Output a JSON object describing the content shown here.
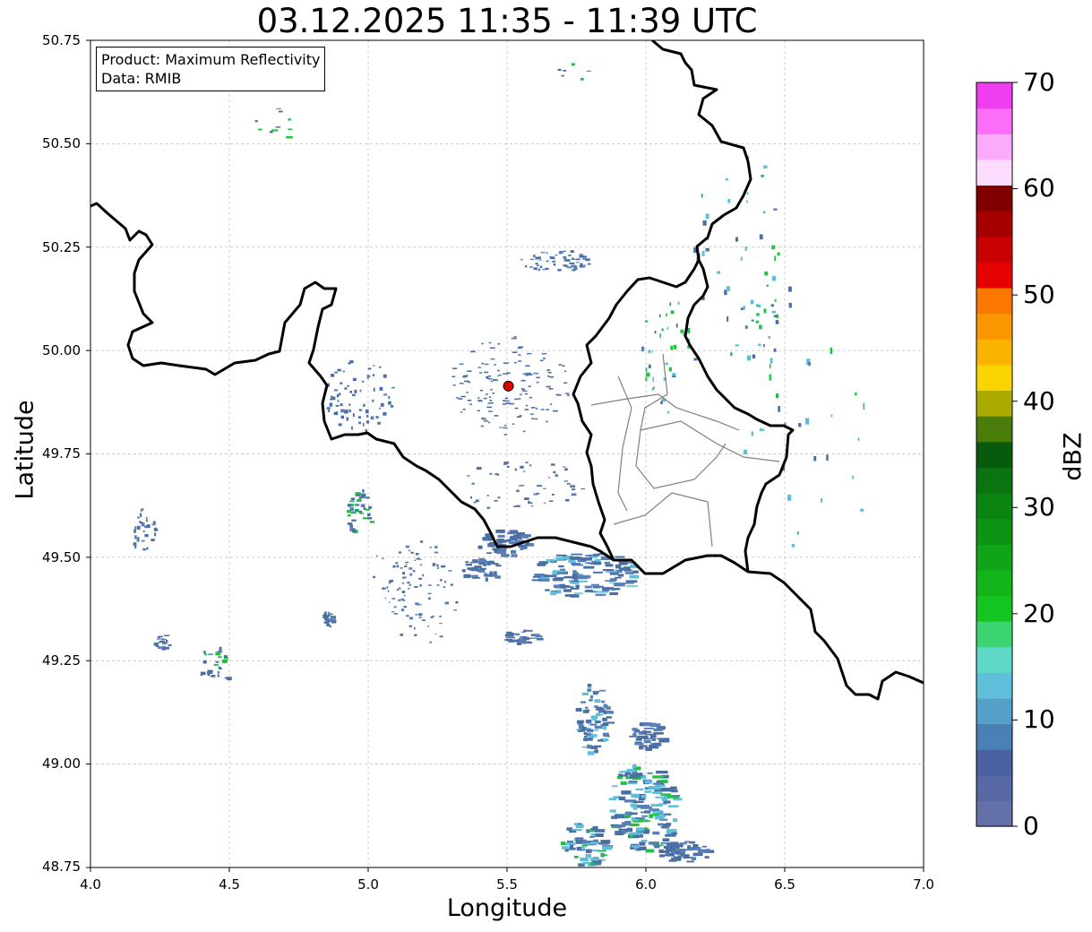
{
  "title": "03.12.2025 11:35 - 11:39 UTC",
  "info": {
    "product": "Product: Maximum Reflectivity",
    "data_source": "Data: RMIB"
  },
  "axes": {
    "xlabel": "Longitude",
    "ylabel": "Latitude",
    "xlim": [
      4.0,
      7.0
    ],
    "ylim": [
      48.75,
      50.75
    ],
    "xticks": [
      "4.0",
      "4.5",
      "5.0",
      "5.5",
      "6.0",
      "6.5",
      "7.0"
    ],
    "yticks": [
      "50.75",
      "50.50",
      "50.25",
      "50.00",
      "49.75",
      "49.50",
      "49.25",
      "49.00",
      "48.75"
    ],
    "grid": true
  },
  "colorbar": {
    "label": "dBZ",
    "ticks": [
      "70",
      "60",
      "50",
      "40",
      "30",
      "20",
      "10",
      "0"
    ],
    "colors": [
      "#6470a8",
      "#5868a4",
      "#4a60a0",
      "#4a80b4",
      "#54a0c8",
      "#60c0dc",
      "#60d8c8",
      "#3cd470",
      "#14c420",
      "#12b41a",
      "#10a418",
      "#0e9414",
      "#0c8412",
      "#0a7410",
      "#085a0c",
      "#4a7c0a",
      "#aaaa00",
      "#fad400",
      "#fab400",
      "#fa9600",
      "#fa7800",
      "#e60000",
      "#c80000",
      "#a40000",
      "#800000",
      "#fcdcfc",
      "#fcaafc",
      "#fc6ef8",
      "#ee3ef0"
    ]
  },
  "radar_site": {
    "lon": 5.505,
    "lat": 49.914,
    "color": "#e00000"
  },
  "borders": {
    "national_color": "#000000",
    "regional_color": "#808080"
  },
  "echo_palette": {
    "low": "#4a6fa5",
    "light": "#5a7fb5",
    "cyan": "#5fbfd8",
    "green": "#20c040"
  }
}
